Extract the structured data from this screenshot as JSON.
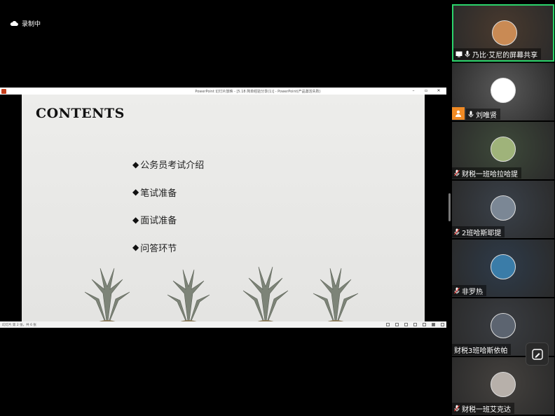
{
  "recording": {
    "label": "录制中",
    "icon": "cloud-icon"
  },
  "ppt": {
    "window_title": "PowerPoint 幻灯片放映 - [5.18 简单经验分享(1)] - PowerPoint(产品激活失败)",
    "slide_title": "CONTENTS",
    "items": [
      {
        "bullet": "◆",
        "text": "公务员考试介绍"
      },
      {
        "bullet": "◆",
        "text": "笔试准备"
      },
      {
        "bullet": "◆",
        "text": "面试准备"
      },
      {
        "bullet": "◆",
        "text": "问答环节"
      }
    ],
    "status_text": "幻灯片 第 2 张，共 6 张",
    "window_controls": [
      "–",
      "▫",
      "✕"
    ]
  },
  "participants": [
    {
      "name": "乃比·艾尼的屏幕共享",
      "avatar_color": "#c98a54",
      "active": true,
      "mic": "on",
      "screen_share_icon": true,
      "tile_bg": "#4a3a2e"
    },
    {
      "name": "刘唯贤",
      "avatar_color": "#ffffff",
      "mic": "on",
      "host": true,
      "tile_bg": "#5a5a5a"
    },
    {
      "name": "财税一班哈拉哈提",
      "avatar_color": "#9fb37a",
      "mic": "muted",
      "tile_bg": "#3e4a3a"
    },
    {
      "name": "2班哈斯耶提",
      "avatar_color": "#7b8795",
      "mic": "muted",
      "tile_bg": "#3a414a"
    },
    {
      "name": "非罗热",
      "avatar_color": "#3a7ca8",
      "mic": "muted",
      "tile_bg": "#2e3b4a"
    },
    {
      "name": "财税3班哈斯依帕",
      "avatar_color": "#5c6470",
      "mic": "none",
      "tile_bg": "#3a3d42"
    },
    {
      "name": "财税一班艾克达",
      "avatar_color": "#b7b0aa",
      "mic": "muted",
      "tile_bg": "#45423f"
    }
  ],
  "colors": {
    "active_border": "#2bd36b",
    "host_badge": "#f08a24",
    "muted_slash": "#e53935"
  }
}
